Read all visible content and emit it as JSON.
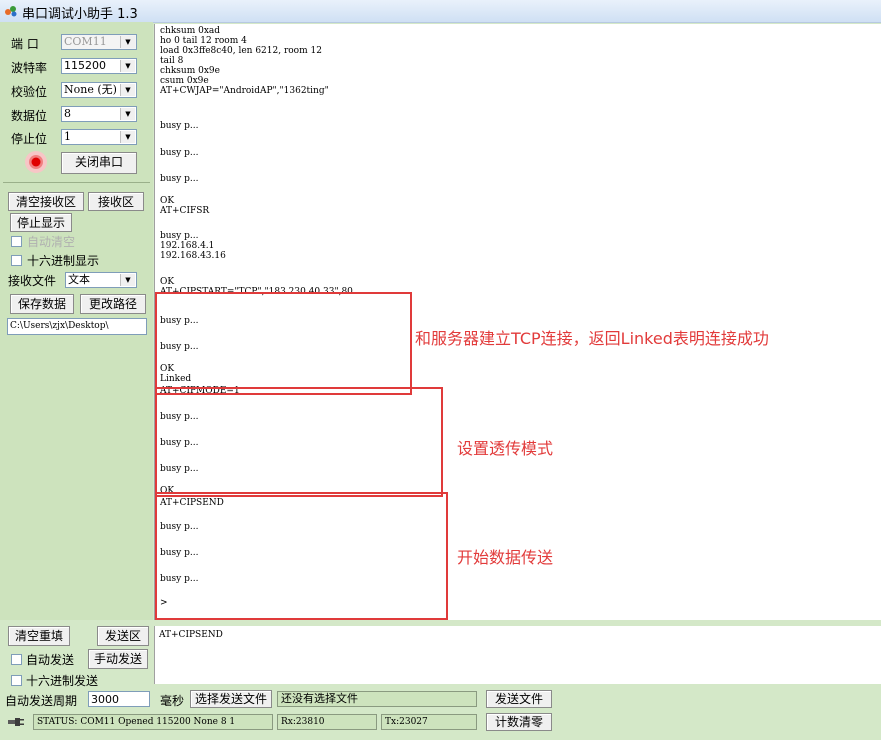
{
  "window": {
    "title": "串口调试小助手 1.3"
  },
  "settings": {
    "port_label": "端  口",
    "port_value": "COM11",
    "baud_label": "波特率",
    "baud_value": "115200",
    "parity_label": "校验位",
    "parity_value": "None (无)",
    "databits_label": "数据位",
    "databits_value": "8",
    "stopbits_label": "停止位",
    "stopbits_value": "1",
    "close_port_label": "关闭串口"
  },
  "receive_controls": {
    "clear_receive_label": "清空接收区",
    "receive_area_label": "接收区",
    "stop_display_label": "停止显示",
    "auto_clear_label": "自动清空",
    "hex_display_label": "十六进制显示",
    "receive_file_label": "接收文件",
    "receive_file_value": "文本",
    "save_data_label": "保存数据",
    "change_path_label": "更改路径",
    "path_value": "C:\\Users\\zjx\\Desktop\\"
  },
  "receive_lines": [
    "chksum 0xad",
    "ho 0 tail 12 room 4",
    "load 0x3ffe8c40, len 6212, room 12",
    "tail 8",
    "chksum 0x9e",
    "csum 0x9e",
    "AT+CWJAP=\"AndroidAP\",\"1362ting\"",
    "busy p...",
    "busy p...",
    "busy p...",
    "OK",
    "AT+CIFSR",
    "busy p...",
    "192.168.4.1",
    "192.168.43.16",
    "OK",
    "AT+CIPSTART=\"TCP\",\"183.230.40.33\",80",
    "busy p...",
    "busy p...",
    "OK",
    "Linked",
    "AT+CIPMODE=1",
    "busy p...",
    "busy p...",
    "busy p...",
    "OK",
    "AT+CIPSEND",
    "busy p...",
    "busy p...",
    "busy p...",
    ">"
  ],
  "annotations": {
    "tcp": "和服务器建立TCP连接，返回Linked表明连接成功",
    "transparent": "设置透传模式",
    "send": "开始数据传送"
  },
  "send_controls": {
    "clear_resend_label": "清空重填",
    "send_area_label": "发送区",
    "auto_send_label": "自动发送",
    "manual_send_label": "手动发送",
    "hex_send_label": "十六进制发送",
    "auto_period_label": "自动发送周期",
    "auto_period_value": "3000",
    "ms_label": "毫秒",
    "choose_file_label": "选择发送文件",
    "file_status_value": "还没有选择文件",
    "send_file_label": "发送文件",
    "reset_count_label": "计数清零",
    "send_text": "AT+CIPSEND"
  },
  "status": {
    "status_text": "STATUS: COM11 Opened 115200 None  8 1",
    "rx_text": "Rx:23810",
    "tx_text": "Tx:23027"
  },
  "colors": {
    "annotation_red": "#e23b3b",
    "panel_green": "#cde3bd",
    "indicator_red": "#e00000"
  }
}
